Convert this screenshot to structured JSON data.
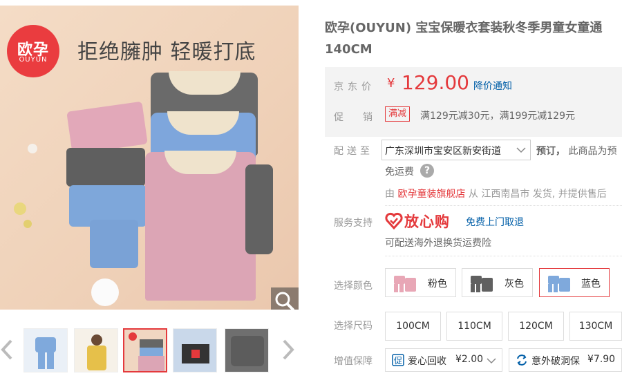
{
  "gallery": {
    "brand_logo_cn": "欧孕",
    "brand_logo_en": "OUYUN",
    "headline": "拒绝臃肿 轻暖打底",
    "thumbnails": [
      {
        "name": "blue-set"
      },
      {
        "name": "child-yellow"
      },
      {
        "name": "stacked-tops"
      },
      {
        "name": "fabric-detail"
      },
      {
        "name": "grey-fabric"
      }
    ],
    "active_thumbnail_index": 2
  },
  "product": {
    "title_line1": "欧孕(OUYUN) 宝宝保暖衣套装秋冬季男童女童通",
    "title_line2": "140CM"
  },
  "price": {
    "label": "京东价",
    "currency": "¥",
    "value": "129.00",
    "notify_link": "降价通知"
  },
  "promo": {
    "label": "促销",
    "tag": "满减",
    "text": "满129元减30元，满199元减129元"
  },
  "delivery": {
    "label": "配送至",
    "address": "广东深圳市宝安区新安街道",
    "preorder_bold": "预订，",
    "preorder_text": "此商品为预",
    "free_shipping": "免运费",
    "ship_prefix": "由",
    "shop_name": "欧孕童装旗舰店",
    "ship_suffix": "从 江西南昌市 发货, 并提供售后"
  },
  "service": {
    "label": "服务支持",
    "assure_brand": "放心购",
    "assure_link": "免费上门取退",
    "overseas": "可配送海外退换货运费险"
  },
  "color": {
    "label": "选择颜色",
    "options": [
      {
        "label": "粉色",
        "swatch": "#e8a7b6"
      },
      {
        "label": "灰色",
        "swatch": "#606060"
      },
      {
        "label": "蓝色",
        "swatch": "#7fa9dc"
      }
    ],
    "selected_index": 2
  },
  "size": {
    "label": "选择尺码",
    "options": [
      "100CM",
      "110CM",
      "120CM",
      "130CM"
    ]
  },
  "addons": {
    "label": "增值保障",
    "items": [
      {
        "icon": "shield-check-icon",
        "label": "爱心回收",
        "price": "¥2.00"
      },
      {
        "icon": "refresh-icon",
        "label": "意外破洞保",
        "price": "¥7.90"
      }
    ]
  },
  "colors": {
    "accent": "#e4393c",
    "link": "#005ea7",
    "muted": "#999999"
  }
}
